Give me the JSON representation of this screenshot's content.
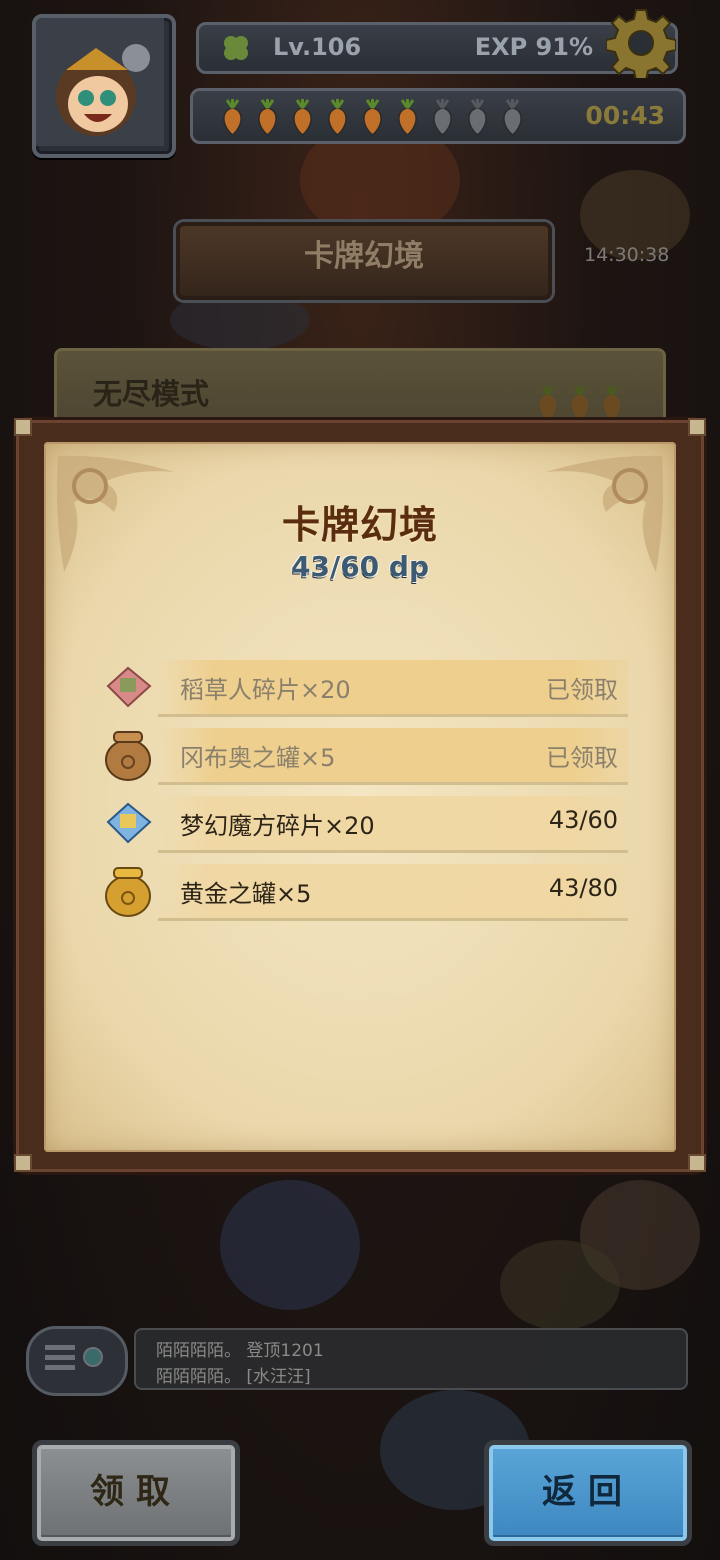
{
  "hud": {
    "level": "Lv.106",
    "exp": "EXP 91%",
    "stamina_total": 9,
    "stamina_filled": 6,
    "timer": "00:43",
    "clock": "14:30:38"
  },
  "header": {
    "plank_title": "卡牌幻境"
  },
  "background_card": {
    "title": "无尽模式"
  },
  "modal": {
    "title": "卡牌幻境",
    "progress": "43/60 dp",
    "rewards": [
      {
        "label": "稻草人碎片×20",
        "status": "已领取",
        "claimed": true,
        "icon": "scarecrow-puzzle-icon"
      },
      {
        "label": "冈布奥之罐×5",
        "status": "已领取",
        "claimed": true,
        "icon": "bronze-jar-icon"
      },
      {
        "label": "梦幻魔方碎片×20",
        "status": "43/60",
        "claimed": false,
        "icon": "cube-puzzle-icon"
      },
      {
        "label": "黄金之罐×5",
        "status": "43/80",
        "claimed": false,
        "icon": "gold-jar-icon"
      }
    ]
  },
  "chat": {
    "line1": "陌陌陌陌。 登顶1201",
    "line2": "陌陌陌陌。 [水汪汪]"
  },
  "buttons": {
    "claim": "领取",
    "back": "返回"
  },
  "colors": {
    "parchment": "#ead7ab",
    "frame": "#4a2c1d",
    "title_text": "#5a2c10",
    "progress_text": "#3d5a75",
    "back_button": "#4a96cc",
    "claim_button": "#7d8082"
  }
}
